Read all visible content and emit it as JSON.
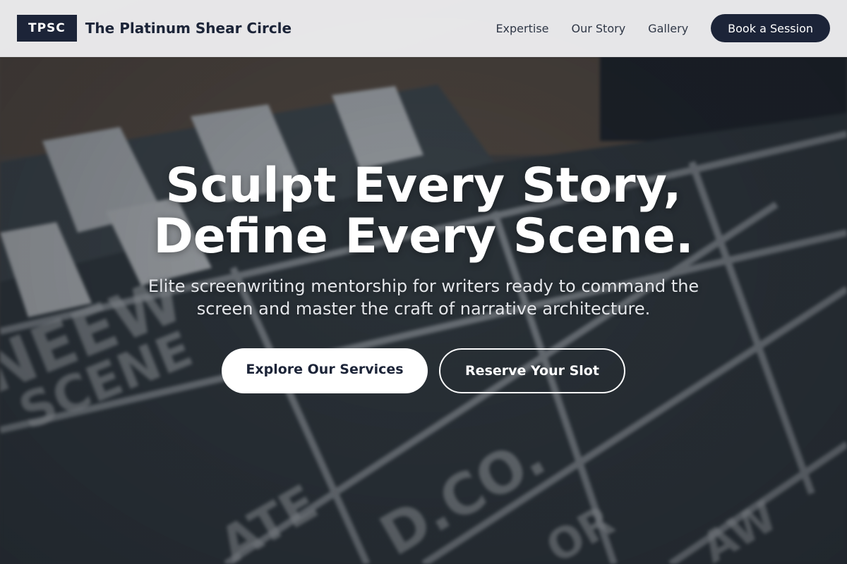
{
  "header": {
    "logo": "TPSC",
    "brand": "The Platinum Shear Circle",
    "nav": [
      "Expertise",
      "Our Story",
      "Gallery"
    ],
    "cta": "Book a Session"
  },
  "hero": {
    "title_line1": "Sculpt Every Story,",
    "title_line2": "Define Every Scene.",
    "subtitle": "Elite screenwriting mentorship for writers ready to command the screen and master the craft of narrative architecture.",
    "primary_button": "Explore Our Services",
    "secondary_button": "Reserve Your Slot",
    "background_image": "blurred film clapperboard"
  },
  "colors": {
    "navy": "#1c2438",
    "header_bg": "#eeeef0",
    "white": "#ffffff"
  }
}
